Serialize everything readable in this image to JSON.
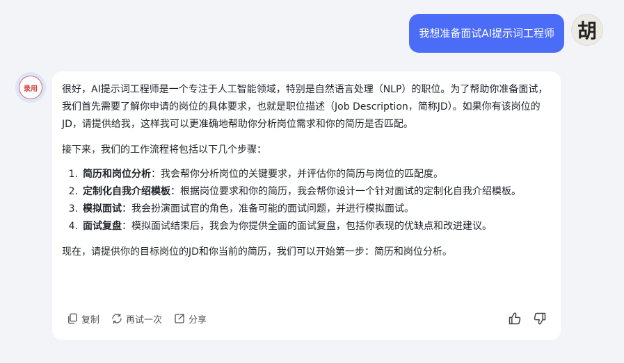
{
  "user": {
    "message": "我想准备面试AI提示词工程师",
    "avatar_text": "胡"
  },
  "bot": {
    "avatar_text": "录用",
    "paragraph1": "很好，AI提示词工程师是一个专注于人工智能领域，特别是自然语言处理（NLP）的职位。为了帮助你准备面试，我们首先需要了解你申请的岗位的具体要求，也就是职位描述（Job Description，简称JD）。如果你有该岗位的JD，请提供给我，这样我可以更准确地帮助你分析岗位需求和你的简历是否匹配。",
    "paragraph2": "接下来，我们的工作流程将包括以下几个步骤：",
    "steps": [
      {
        "num": "1.",
        "title": "简历和岗位分析",
        "text": "：我会帮你分析岗位的关键要求，并评估你的简历与岗位的匹配度。"
      },
      {
        "num": "2.",
        "title": "定制化自我介绍模板",
        "text": "：根据岗位要求和你的简历，我会帮你设计一个针对面试的定制化自我介绍模板。"
      },
      {
        "num": "3.",
        "title": "模拟面试",
        "text": "：我会扮演面试官的角色，准备可能的面试问题，并进行模拟面试。"
      },
      {
        "num": "4.",
        "title": "面试复盘",
        "text": "：模拟面试结束后，我会为你提供全面的面试复盘，包括你表现的优缺点和改进建议。"
      }
    ],
    "paragraph3": "现在，请提供你的目标岗位的JD和你当前的简历，我们可以开始第一步：简历和岗位分析。"
  },
  "actions": {
    "copy_label": "复制",
    "retry_label": "再试一次",
    "share_label": "分享"
  },
  "colors": {
    "user_bubble": "#4b6cf7",
    "background": "#f3f4f8",
    "card": "#ffffff"
  },
  "icons": [
    "copy-icon",
    "retry-icon",
    "share-icon",
    "thumbs-up-icon",
    "thumbs-down-icon"
  ]
}
